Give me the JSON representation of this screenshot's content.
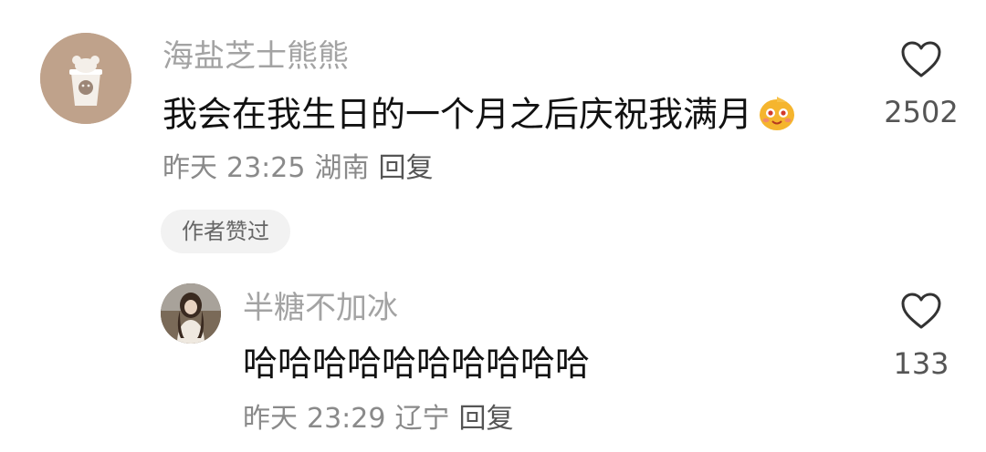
{
  "comment": {
    "username": "海盐芝士熊熊",
    "text": "我会在我生日的一个月之后庆祝我满月",
    "emoji": "smiling-blush-emoji",
    "date": "昨天",
    "time": "23:25",
    "location": "湖南",
    "reply_label": "回复",
    "like_count": "2502",
    "author_liked_badge": "作者赞过"
  },
  "reply": {
    "username": "半糖不加冰",
    "text": "哈哈哈哈哈哈哈哈哈哈",
    "date": "昨天",
    "time": "23:29",
    "location": "辽宁",
    "reply_label": "回复",
    "like_count": "133"
  },
  "colors": {
    "username": "#a3a3a3",
    "text": "#111111",
    "meta": "#8a8a8a",
    "badge_bg": "#f2f2f2"
  }
}
